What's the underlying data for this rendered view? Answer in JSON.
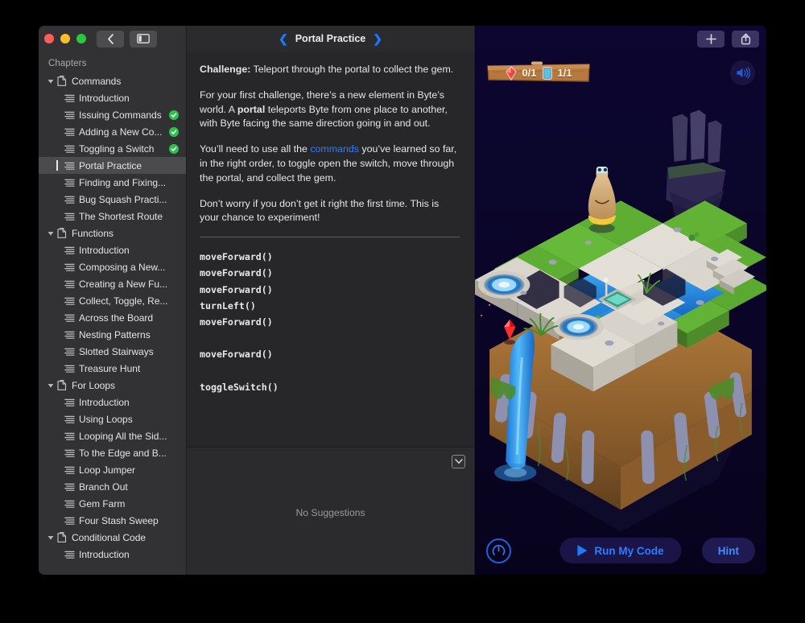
{
  "window": {
    "traffic_lights": [
      "close",
      "minimize",
      "zoom"
    ],
    "back_button": "back-chevron",
    "sidebar_toggle": "sidebar-toggle"
  },
  "sidebar": {
    "header": "Chapters",
    "groups": [
      {
        "title": "Commands",
        "expanded": true,
        "pages": [
          {
            "label": "Introduction",
            "done": false,
            "selected": false
          },
          {
            "label": "Issuing Commands",
            "done": true,
            "selected": false
          },
          {
            "label": "Adding a New Co...",
            "done": true,
            "selected": false
          },
          {
            "label": "Toggling a Switch",
            "done": true,
            "selected": false
          },
          {
            "label": "Portal Practice",
            "done": false,
            "selected": true
          },
          {
            "label": "Finding and Fixing...",
            "done": false,
            "selected": false
          },
          {
            "label": "Bug Squash Practi...",
            "done": false,
            "selected": false
          },
          {
            "label": "The Shortest Route",
            "done": false,
            "selected": false
          }
        ]
      },
      {
        "title": "Functions",
        "expanded": true,
        "pages": [
          {
            "label": "Introduction",
            "done": false,
            "selected": false
          },
          {
            "label": "Composing a New...",
            "done": false,
            "selected": false
          },
          {
            "label": "Creating a New Fu...",
            "done": false,
            "selected": false
          },
          {
            "label": "Collect, Toggle, Re...",
            "done": false,
            "selected": false
          },
          {
            "label": "Across the Board",
            "done": false,
            "selected": false
          },
          {
            "label": "Nesting Patterns",
            "done": false,
            "selected": false
          },
          {
            "label": "Slotted Stairways",
            "done": false,
            "selected": false
          },
          {
            "label": "Treasure Hunt",
            "done": false,
            "selected": false
          }
        ]
      },
      {
        "title": "For Loops",
        "expanded": true,
        "pages": [
          {
            "label": "Introduction",
            "done": false,
            "selected": false
          },
          {
            "label": "Using Loops",
            "done": false,
            "selected": false
          },
          {
            "label": "Looping All the Sid...",
            "done": false,
            "selected": false
          },
          {
            "label": "To the Edge and B...",
            "done": false,
            "selected": false
          },
          {
            "label": "Loop Jumper",
            "done": false,
            "selected": false
          },
          {
            "label": "Branch Out",
            "done": false,
            "selected": false
          },
          {
            "label": "Gem Farm",
            "done": false,
            "selected": false
          },
          {
            "label": "Four Stash Sweep",
            "done": false,
            "selected": false
          }
        ]
      },
      {
        "title": "Conditional Code",
        "expanded": true,
        "pages": [
          {
            "label": "Introduction",
            "done": false,
            "selected": false
          }
        ]
      }
    ]
  },
  "center": {
    "title": "Portal Practice",
    "prev_icon": "chevron-left-icon",
    "next_icon": "chevron-right-icon",
    "content": {
      "challenge_label": "Challenge:",
      "challenge_text": " Teleport through the portal to collect the gem.",
      "p2_a": "For your first challenge, there’s a new element in Byte’s world. A ",
      "p2_b": "portal",
      "p2_c": " teleports Byte from one place to another, with Byte facing the same direction going in and out.",
      "p3_a": "You’ll need to use all the ",
      "p3_link": "commands",
      "p3_c": " you’ve learned so far, in the right order, to toggle open the switch, move through the portal, and collect the gem.",
      "p4": "Don’t worry if you don’t get it right the first time. This is your chance to experiment!"
    },
    "code_lines": [
      "moveForward()",
      "moveForward()",
      "moveForward()",
      "turnLeft()",
      "moveForward()",
      "",
      "moveForward()",
      "",
      "toggleSwitch()"
    ],
    "suggestions": {
      "empty_text": "No Suggestions",
      "collapse_icon": "chevron-down-icon"
    }
  },
  "game": {
    "add_button": "add-icon",
    "share_button": "share-icon",
    "audio_button": "speaker-icon",
    "counters": [
      {
        "icon": "gem-icon",
        "value": "0/1"
      },
      {
        "icon": "switch-icon",
        "value": "1/1"
      }
    ],
    "speed_dial": "speed-dial-icon",
    "run_label": "Run My Code",
    "run_icon": "play-icon",
    "hint_label": "Hint",
    "colors": {
      "sky": "#0a0527",
      "accent_blue": "#2f7dff",
      "grass": "#57a12b",
      "water": "#1c7fe0",
      "stone": "#d8d4cb",
      "dirt": "#a9743c"
    }
  }
}
